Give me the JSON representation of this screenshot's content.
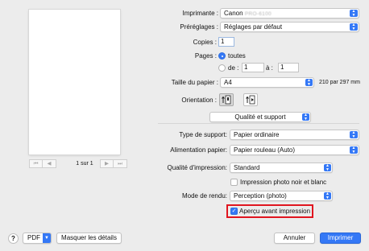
{
  "preview": {
    "page_count": "1 sur 1",
    "nav": {
      "first": "⏮",
      "prev": "◀",
      "next": "▶",
      "last": "⏭"
    }
  },
  "printer": {
    "label": "Imprimante :",
    "value_prefix": "Canon",
    "value_redacted": "PRO-6100"
  },
  "presets": {
    "label": "Préréglages :",
    "value": "Réglages par défaut"
  },
  "copies": {
    "label": "Copies :",
    "value": "1"
  },
  "pages": {
    "label": "Pages :",
    "all_label": "toutes",
    "from_label": "de :",
    "from_value": "1",
    "to_label": "à :",
    "to_value": "1",
    "selected": "all"
  },
  "paper_size": {
    "label": "Taille du papier :",
    "value": "A4",
    "dimensions": "210 par 297 mm"
  },
  "orientation": {
    "label": "Orientation :",
    "selected": "portrait"
  },
  "panel_select": {
    "value": "Qualité et support"
  },
  "media_type": {
    "label": "Type de support:",
    "value": "Papier ordinaire"
  },
  "paper_source": {
    "label": "Alimentation papier:",
    "value": "Papier rouleau (Auto)"
  },
  "print_quality": {
    "label": "Qualité d'impression:",
    "value": "Standard"
  },
  "bw_photo": {
    "label": "Impression photo noir et blanc",
    "checked": false
  },
  "render_mode": {
    "label": "Mode de rendu:",
    "value": "Perception (photo)"
  },
  "preview_before_print": {
    "label": "Aperçu avant impression",
    "checked": true
  },
  "bottom": {
    "help": "?",
    "pdf": "PDF",
    "hide_details": "Masquer les détails",
    "cancel": "Annuler",
    "print": "Imprimer"
  },
  "colors": {
    "accent": "#3478f6",
    "highlight": "#e0151f",
    "background": "#ececec"
  }
}
